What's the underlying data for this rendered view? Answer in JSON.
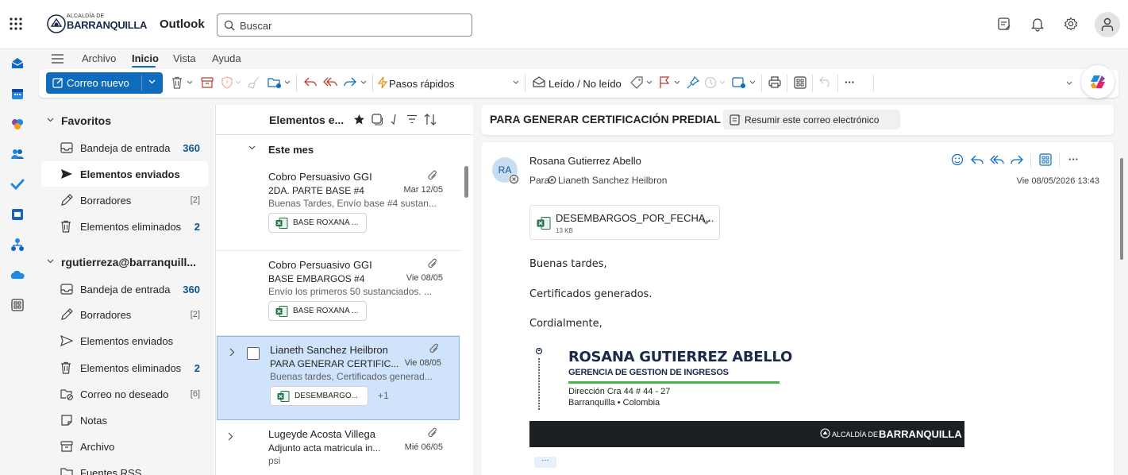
{
  "header": {
    "brand_small": "ALCALDÍA DE",
    "brand_big": "BARRANQUILLA",
    "app_name": "Outlook",
    "search_placeholder": "Buscar"
  },
  "menu": {
    "items": [
      "Archivo",
      "Inicio",
      "Vista",
      "Ayuda"
    ],
    "active": "Inicio"
  },
  "toolbar": {
    "new_mail": "Correo nuevo",
    "quick_steps": "Pasos rápidos",
    "read_unread": "Leído / No leído",
    "more": "···"
  },
  "folders": {
    "favorites_title": "Favoritos",
    "favorites": [
      {
        "label": "Bandeja de entrada",
        "count": "360",
        "icon": "inbox-icon"
      },
      {
        "label": "Elementos enviados",
        "count": "",
        "icon": "sent-icon",
        "selected": true
      },
      {
        "label": "Borradores",
        "count": "[2]",
        "icon": "drafts-icon"
      },
      {
        "label": "Elementos eliminados",
        "count": "2",
        "icon": "trash-icon"
      }
    ],
    "account_title": "rgutierreza@barranquill...",
    "account": [
      {
        "label": "Bandeja de entrada",
        "count": "360",
        "icon": "inbox-icon"
      },
      {
        "label": "Borradores",
        "count": "[2]",
        "icon": "drafts-icon"
      },
      {
        "label": "Elementos enviados",
        "count": "",
        "icon": "sent-icon"
      },
      {
        "label": "Elementos eliminados",
        "count": "2",
        "icon": "trash-icon"
      },
      {
        "label": "Correo no deseado",
        "count": "[6]",
        "icon": "junk-icon"
      },
      {
        "label": "Notas",
        "count": "",
        "icon": "notes-icon"
      },
      {
        "label": "Archivo",
        "count": "",
        "icon": "archive-icon"
      },
      {
        "label": "Fuentes RSS",
        "count": "",
        "icon": "rss-folder-icon"
      }
    ]
  },
  "message_list": {
    "title": "Elementos e...",
    "group_label": "Este mes",
    "messages": [
      {
        "sender": "Cobro Persuasivo GGI",
        "subject": "2DA. PARTE BASE #4",
        "date": "Mar 12/05",
        "preview": "Buenas Tardes, Envío base #4 sustan...",
        "attachment": "BASE ROXANA ...",
        "extra": ""
      },
      {
        "sender": "Cobro Persuasivo GGI",
        "subject": "BASE EMBARGOS #4",
        "date": "Vie 08/05",
        "preview": "Envío los primeros 50 sustanciados. ...",
        "attachment": "BASE ROXANA ...",
        "extra": ""
      },
      {
        "sender": "Lianeth Sanchez Heilbron",
        "subject": "PARA GENERAR CERTIFIC...",
        "date": "Vie 08/05",
        "preview": "Buenas tardes, Certificados generad...",
        "attachment": "DESEMBARGO...",
        "extra": "+1",
        "selected": true
      },
      {
        "sender": "Lugeyde Acosta Villega",
        "subject": "Adjunto acta matricula in...",
        "date": "Mié 06/05",
        "preview": "psi",
        "attachment": "",
        "extra": ""
      }
    ]
  },
  "reading": {
    "subject": "PARA GENERAR CERTIFICACIÓN PREDIAL",
    "summarize": "Resumir este correo electrónico",
    "avatar_initials": "RA",
    "from": "Rosana Gutierrez Abello",
    "to_label": "Para:",
    "to_name": "Lianeth Sanchez Heilbron",
    "date": "Vie 08/05/2026 13:43",
    "attachment_name": "DESEMBARGOS_POR_FECHA...",
    "attachment_size": "13 KB",
    "body": [
      "Buenas tardes,",
      "Certificados generados.",
      "Cordialmente,"
    ],
    "signature": {
      "name": "ROSANA GUTIERREZ ABELLO",
      "dept": "GERENCIA DE GESTION DE INGRESOS",
      "address": "Dirección Cra 44 # 44 - 27",
      "city": "Barranquilla • Colombia",
      "banner_small": "ALCALDÍA DE",
      "banner_big": "BARRANQUILLA"
    },
    "more": "···"
  },
  "colors": {
    "accent": "#0f6cbd",
    "selected_row": "#cfe4fa",
    "unread_count": "#0f548c",
    "signature_green": "#4caf50",
    "banner_bg": "#1c2023"
  }
}
